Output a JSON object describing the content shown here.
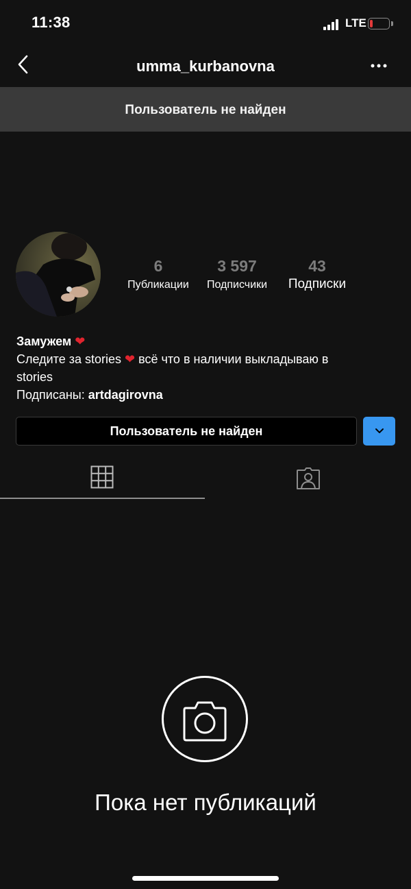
{
  "status_bar": {
    "time": "11:38",
    "network": "LTE",
    "battery_level": 0.15
  },
  "nav": {
    "username": "umma_kurbanovna",
    "back_icon": "chevron-left-icon",
    "more_icon": "more-horizontal-icon"
  },
  "banner": {
    "text": "Пользователь не найден"
  },
  "profile": {
    "stats": [
      {
        "value": "6",
        "label": "Публикации"
      },
      {
        "value": "3 597",
        "label": "Подписчики"
      },
      {
        "value": "43",
        "label": "Подписки"
      }
    ],
    "bio": {
      "line1_text": "Замужем",
      "line2_text_a": "Следите за stories",
      "line2_text_b": "всё что в наличии выкладываю в",
      "line3_text": "stories",
      "followed_by_label": "Подписаны:",
      "followed_by_user": "artdagirovna"
    }
  },
  "actions": {
    "follow_button_label": "Пользователь не найден",
    "dropdown_icon": "chevron-down-icon"
  },
  "tabs": [
    {
      "name": "grid",
      "icon": "grid-icon",
      "active": true
    },
    {
      "name": "tagged",
      "icon": "tagged-person-icon",
      "active": false
    }
  ],
  "empty_state": {
    "icon": "camera-icon",
    "text": "Пока нет публикаций"
  },
  "colors": {
    "background": "#121212",
    "banner": "#3a3a3a",
    "accent": "#3897f0",
    "heart": "#e0242e"
  }
}
